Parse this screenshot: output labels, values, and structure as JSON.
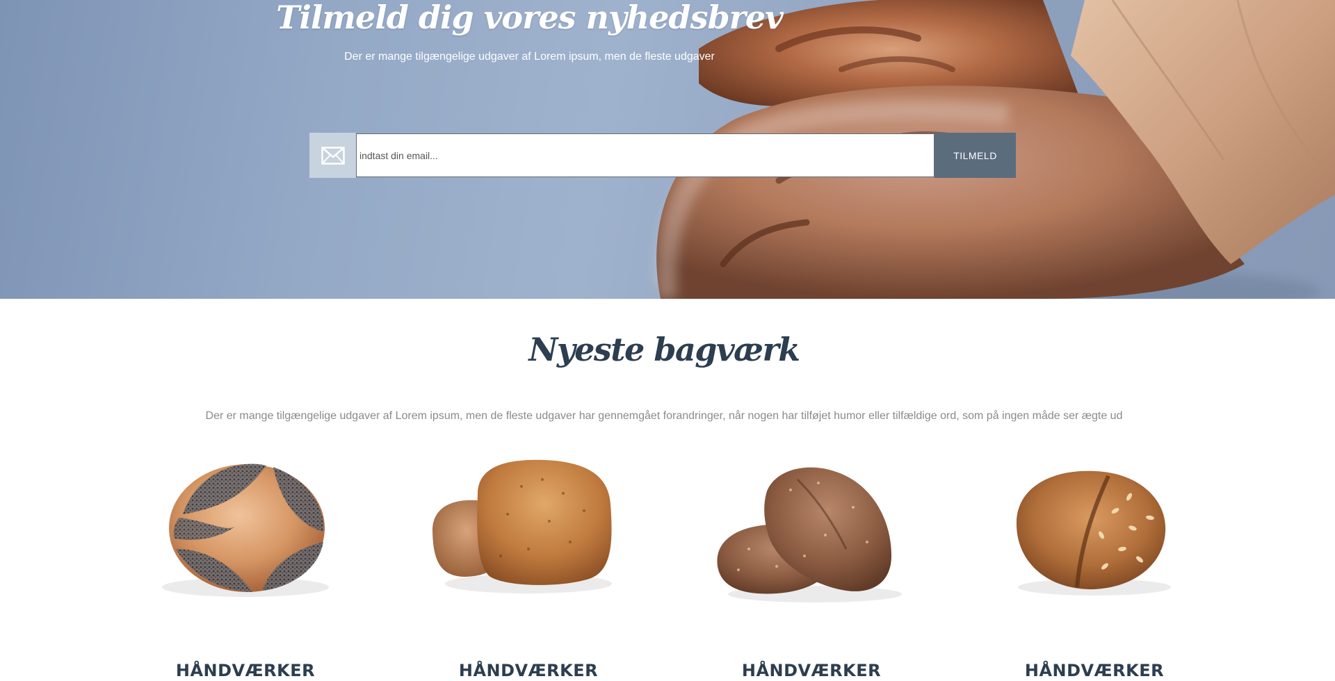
{
  "newsletter": {
    "title": "Tilmeld dig vores nyhedsbrev",
    "subtitle": "Der er mange tilgængelige udgaver af Lorem ipsum, men de fleste udgaver",
    "email_placeholder": "indtast din email...",
    "submit_label": "TILMELD",
    "icon": "envelope-icon"
  },
  "latest": {
    "title": "Nyeste bagværk",
    "description": "Der er mange tilgængelige udgaver af Lorem ipsum, men de fleste udgaver har gennemgået forandringer, når nogen har tilføjet humor eller tilfældige ord, som på ingen måde ser ægte ud",
    "products": [
      {
        "name": "HÅNDVÆRKER",
        "image": "poppy-seed-roll"
      },
      {
        "name": "HÅNDVÆRKER",
        "image": "seeded-bread-rolls"
      },
      {
        "name": "HÅNDVÆRKER",
        "image": "whole-grain-rolls"
      },
      {
        "name": "HÅNDVÆRKER",
        "image": "oat-topped-loaf"
      }
    ]
  },
  "colors": {
    "heading": "#2c3e4f",
    "button": "#5b6c7d",
    "icon_box": "#c7d3df"
  }
}
